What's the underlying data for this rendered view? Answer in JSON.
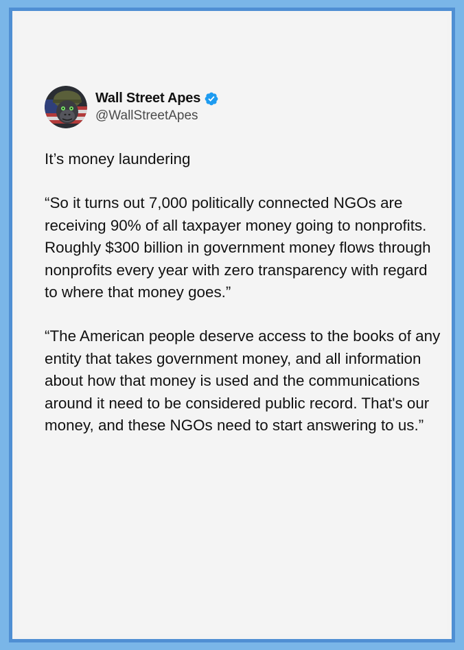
{
  "author": {
    "display_name": "Wall Street Apes",
    "handle": "@WallStreetApes",
    "verified_icon": "verified-badge-icon",
    "avatar_icon": "gorilla-soldier-avatar",
    "verified_color": "#1d9bf0"
  },
  "tweet": {
    "paragraphs": [
      "It’s money laundering",
      "“So it turns out 7,000 politically connected NGOs are receiving 90% of all taxpayer money going to nonprofits. Roughly $300 billion in government money flows through nonprofits every year with zero transparency with regard to where that money goes.”",
      "“The American people deserve access to the books of any entity that takes government money, and all information about how that money is used and the communications around it need to be considered public record. That's our money, and these NGOs need to start answering to us.”"
    ]
  },
  "colors": {
    "frame_blue": "#7ab6e8",
    "border_blue": "#4f8fd3",
    "card_background": "#f4f4f4",
    "text": "#111111"
  }
}
